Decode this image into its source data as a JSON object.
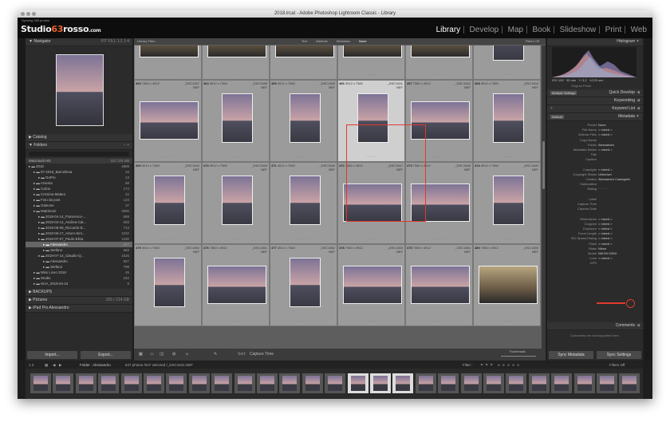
{
  "window": {
    "title": "2018.lrcat - Adobe Photoshop Lightroom Classic - Library"
  },
  "identity": {
    "sync": "Syncing 365 photos",
    "logo_a": "Studio",
    "logo_accent": "63",
    "logo_b": "rosso",
    "logo_c": ".com"
  },
  "modules": [
    "Library",
    "Develop",
    "Map",
    "Book",
    "Slideshow",
    "Print",
    "Web"
  ],
  "left": {
    "navigator": "Navigator",
    "nav_zoom": "FIT  FILL  1:1  1:4",
    "catalog": "Catalog",
    "folders": "Folders",
    "folders_ctrl": "−  +",
    "search_placeholder": "",
    "volume": "Macintosh HD",
    "volume_info": "1/2 / 2/4 GB",
    "folder_rows": [
      {
        "label": "2018",
        "count": "4888"
      },
      {
        "label": "07-2018_Barcellona",
        "count": "33"
      },
      {
        "label": "GoPro",
        "count": "13"
      },
      {
        "label": "Arsenia",
        "count": "68"
      },
      {
        "label": "Calcio",
        "count": "174"
      },
      {
        "label": "Cresima Matteo",
        "count": "22"
      },
      {
        "label": "Foto da post",
        "count": "134"
      },
      {
        "label": "Galeone",
        "count": "37"
      },
      {
        "label": "Matrimoni",
        "count": "3065"
      },
      {
        "label": "2018-04-14_Francesco-...",
        "count": "569"
      },
      {
        "label": "2018-04-14_Andrea-Cat...",
        "count": "683"
      },
      {
        "label": "2018-05-05_Riccardo-E...",
        "count": "713"
      },
      {
        "label": "2018-06-17_Arturo-Sim...",
        "count": "1032"
      },
      {
        "label": "2018-07-07_Paolo-Elisa",
        "count": "1330"
      },
      {
        "label": "Alessandro",
        "count": "647"
      },
      {
        "label": "Stefano",
        "count": "683"
      },
      {
        "label": "2018-07-14_Claudio-Q...",
        "count": "1525"
      },
      {
        "label": "Alessandro",
        "count": "827"
      },
      {
        "label": "Stefano",
        "count": "798"
      },
      {
        "label": "Miss Liceo 2018",
        "count": "45"
      },
      {
        "label": "Studio",
        "count": "242"
      },
      {
        "label": "WJA_2018-04-24",
        "count": "9"
      }
    ],
    "backups": "BACKUPS",
    "pictures": "Pictures",
    "pictures_info": "156 / 214 GB",
    "ipad": "iPad Pro Alessandro",
    "import": "Import...",
    "export": "Export..."
  },
  "center": {
    "filter_label": "Library Filter :",
    "filter_tabs": [
      "Text",
      "Attribute",
      "Metadata",
      "None"
    ],
    "filters_off": "Filters Off",
    "rows": [
      [
        {
          "num": "",
          "name": "",
          "size": "",
          "ext": "",
          "kind": "crowd"
        },
        {
          "num": "",
          "name": "",
          "size": "",
          "ext": "",
          "kind": "crowd"
        },
        {
          "num": "",
          "name": "",
          "size": "",
          "ext": "",
          "kind": "crowd"
        },
        {
          "num": "",
          "name": "",
          "size": "",
          "ext": "",
          "kind": "crowd"
        },
        {
          "num": "",
          "name": "",
          "size": "",
          "ext": "",
          "kind": "crowd"
        },
        {
          "num": "",
          "name": "",
          "size": "",
          "ext": "",
          "kind": "portrait"
        }
      ],
      [
        {
          "num": "463",
          "name": "_DSC1637",
          "size": "7360 x 4912",
          "ext": "NEF",
          "kind": "land"
        },
        {
          "num": "464",
          "name": "_DSC1638",
          "size": "4912 x 7360",
          "ext": "NEF",
          "kind": "portrait"
        },
        {
          "num": "465",
          "name": "_DSC1639",
          "size": "4912 x 7360",
          "ext": "NEF",
          "kind": "portrait"
        },
        {
          "num": "466",
          "name": "_DSC1641",
          "size": "4912 x 7360",
          "ext": "NEF",
          "kind": "portrait"
        },
        {
          "num": "467",
          "name": "_DSC1642",
          "size": "7360 x 4912",
          "ext": "NEF",
          "kind": "land"
        },
        {
          "num": "468",
          "name": "_DSC1643",
          "size": "4912 x 7360",
          "ext": "NEF",
          "kind": "portrait"
        }
      ],
      [
        {
          "num": "469",
          "name": "_DSC1644",
          "size": "4912 x 7360",
          "ext": "NEF",
          "kind": "portrait"
        },
        {
          "num": "470",
          "name": "_DSC1645",
          "size": "4912 x 7360",
          "ext": "NEF",
          "kind": "portrait"
        },
        {
          "num": "471",
          "name": "_DSC1646",
          "size": "4912 x 7360",
          "ext": "NEF",
          "kind": "portrait"
        },
        {
          "num": "472",
          "name": "_DSC1647",
          "size": "7360 x 4912",
          "ext": "NEF",
          "kind": "land"
        },
        {
          "num": "473",
          "name": "_DSC1648",
          "size": "7360 x 4912",
          "ext": "NEF",
          "kind": "land"
        },
        {
          "num": "474",
          "name": "_DSC1649",
          "size": "4912 x 7360",
          "ext": "NEF",
          "kind": "portrait"
        }
      ],
      [
        {
          "num": "475",
          "name": "_DSC1650",
          "size": "4912 x 7360",
          "ext": "NEF",
          "kind": "portrait"
        },
        {
          "num": "476",
          "name": "_DSC1651",
          "size": "7360 x 4912",
          "ext": "NEF",
          "kind": "land"
        },
        {
          "num": "477",
          "name": "_DSC1652",
          "size": "4912 x 7360",
          "ext": "NEF",
          "kind": "portrait"
        },
        {
          "num": "478",
          "name": "_DSC1653",
          "size": "7360 x 4912",
          "ext": "NEF",
          "kind": "land"
        },
        {
          "num": "479",
          "name": "_DSC1654",
          "size": "7360 x 4912",
          "ext": "NEF",
          "kind": "land"
        },
        {
          "num": "480",
          "name": "_DSC1655",
          "size": "7360 x 4912",
          "ext": "NEF",
          "kind": "crowd"
        }
      ]
    ],
    "sort_label": "Sort:",
    "sort_value": "Capture Time",
    "thumbs_label": "Thumbnails"
  },
  "right": {
    "histogram": "Histogram",
    "hist_info": [
      "ISO 100",
      "35 mm",
      "f / 3,2",
      "1/125 sec"
    ],
    "original": "Original Photo",
    "quick_develop": "Quick Develop",
    "saved_preset": "Multiple Settings",
    "keywording": "Keywording",
    "keyword_list": "Keyword List",
    "metadata": "Metadata",
    "metadata_preset_label": "Default",
    "meta_rows": [
      {
        "k": "Preset",
        "v": "None"
      },
      {
        "k": "File Name",
        "v": "< mixed >"
      },
      {
        "k": "Sidecar Files",
        "v": "< mixed >"
      },
      {
        "k": "Copy Name",
        "v": ""
      },
      {
        "k": "Folder",
        "v": "Alessandro"
      },
      {
        "k": "Metadata Status",
        "v": "< mixed >"
      },
      {
        "k": "Title",
        "v": ""
      },
      {
        "k": "Caption",
        "v": ""
      },
      {
        "k": "",
        "v": ""
      },
      {
        "k": "Copyright",
        "v": "< mixed >"
      },
      {
        "k": "Copyright Status",
        "v": "Unknown"
      },
      {
        "k": "Creator",
        "v": "Alessandro Castagnini"
      },
      {
        "k": "Sublocation",
        "v": ""
      },
      {
        "k": "Rating",
        "v": "· · · · ·"
      },
      {
        "k": "",
        "v": ""
      },
      {
        "k": "Label",
        "v": ""
      },
      {
        "k": "Capture Time",
        "v": ""
      },
      {
        "k": "Capture Date",
        "v": ""
      },
      {
        "k": "",
        "v": ""
      },
      {
        "k": "Dimensions",
        "v": "< mixed >"
      },
      {
        "k": "Cropped",
        "v": "< mixed >"
      },
      {
        "k": "Exposure",
        "v": "< mixed >"
      },
      {
        "k": "Focal Length",
        "v": "< mixed >"
      },
      {
        "k": "ISO Speed Rating",
        "v": "< mixed >"
      },
      {
        "k": "Flash",
        "v": "< mixed >"
      },
      {
        "k": "Make",
        "v": "Nikon"
      },
      {
        "k": "Model",
        "v": "NIKON D810"
      },
      {
        "k": "Lens",
        "v": "< mixed >"
      },
      {
        "k": "GPS",
        "v": ""
      }
    ],
    "comments": "Comments",
    "comments_note": "Comments are not supported here.",
    "sync_metadata": "Sync Metadata",
    "sync_settings": "Sync Settings"
  },
  "film": {
    "pages": "1  2",
    "folder": "Folder : Alessandro",
    "count": "647 photos /647 selected /_DSC1641.NEF",
    "filter": "Filter :",
    "filters_off": "Filters Off"
  },
  "colors": {
    "accent": "#e8622c",
    "annotation": "#e03a2f"
  }
}
